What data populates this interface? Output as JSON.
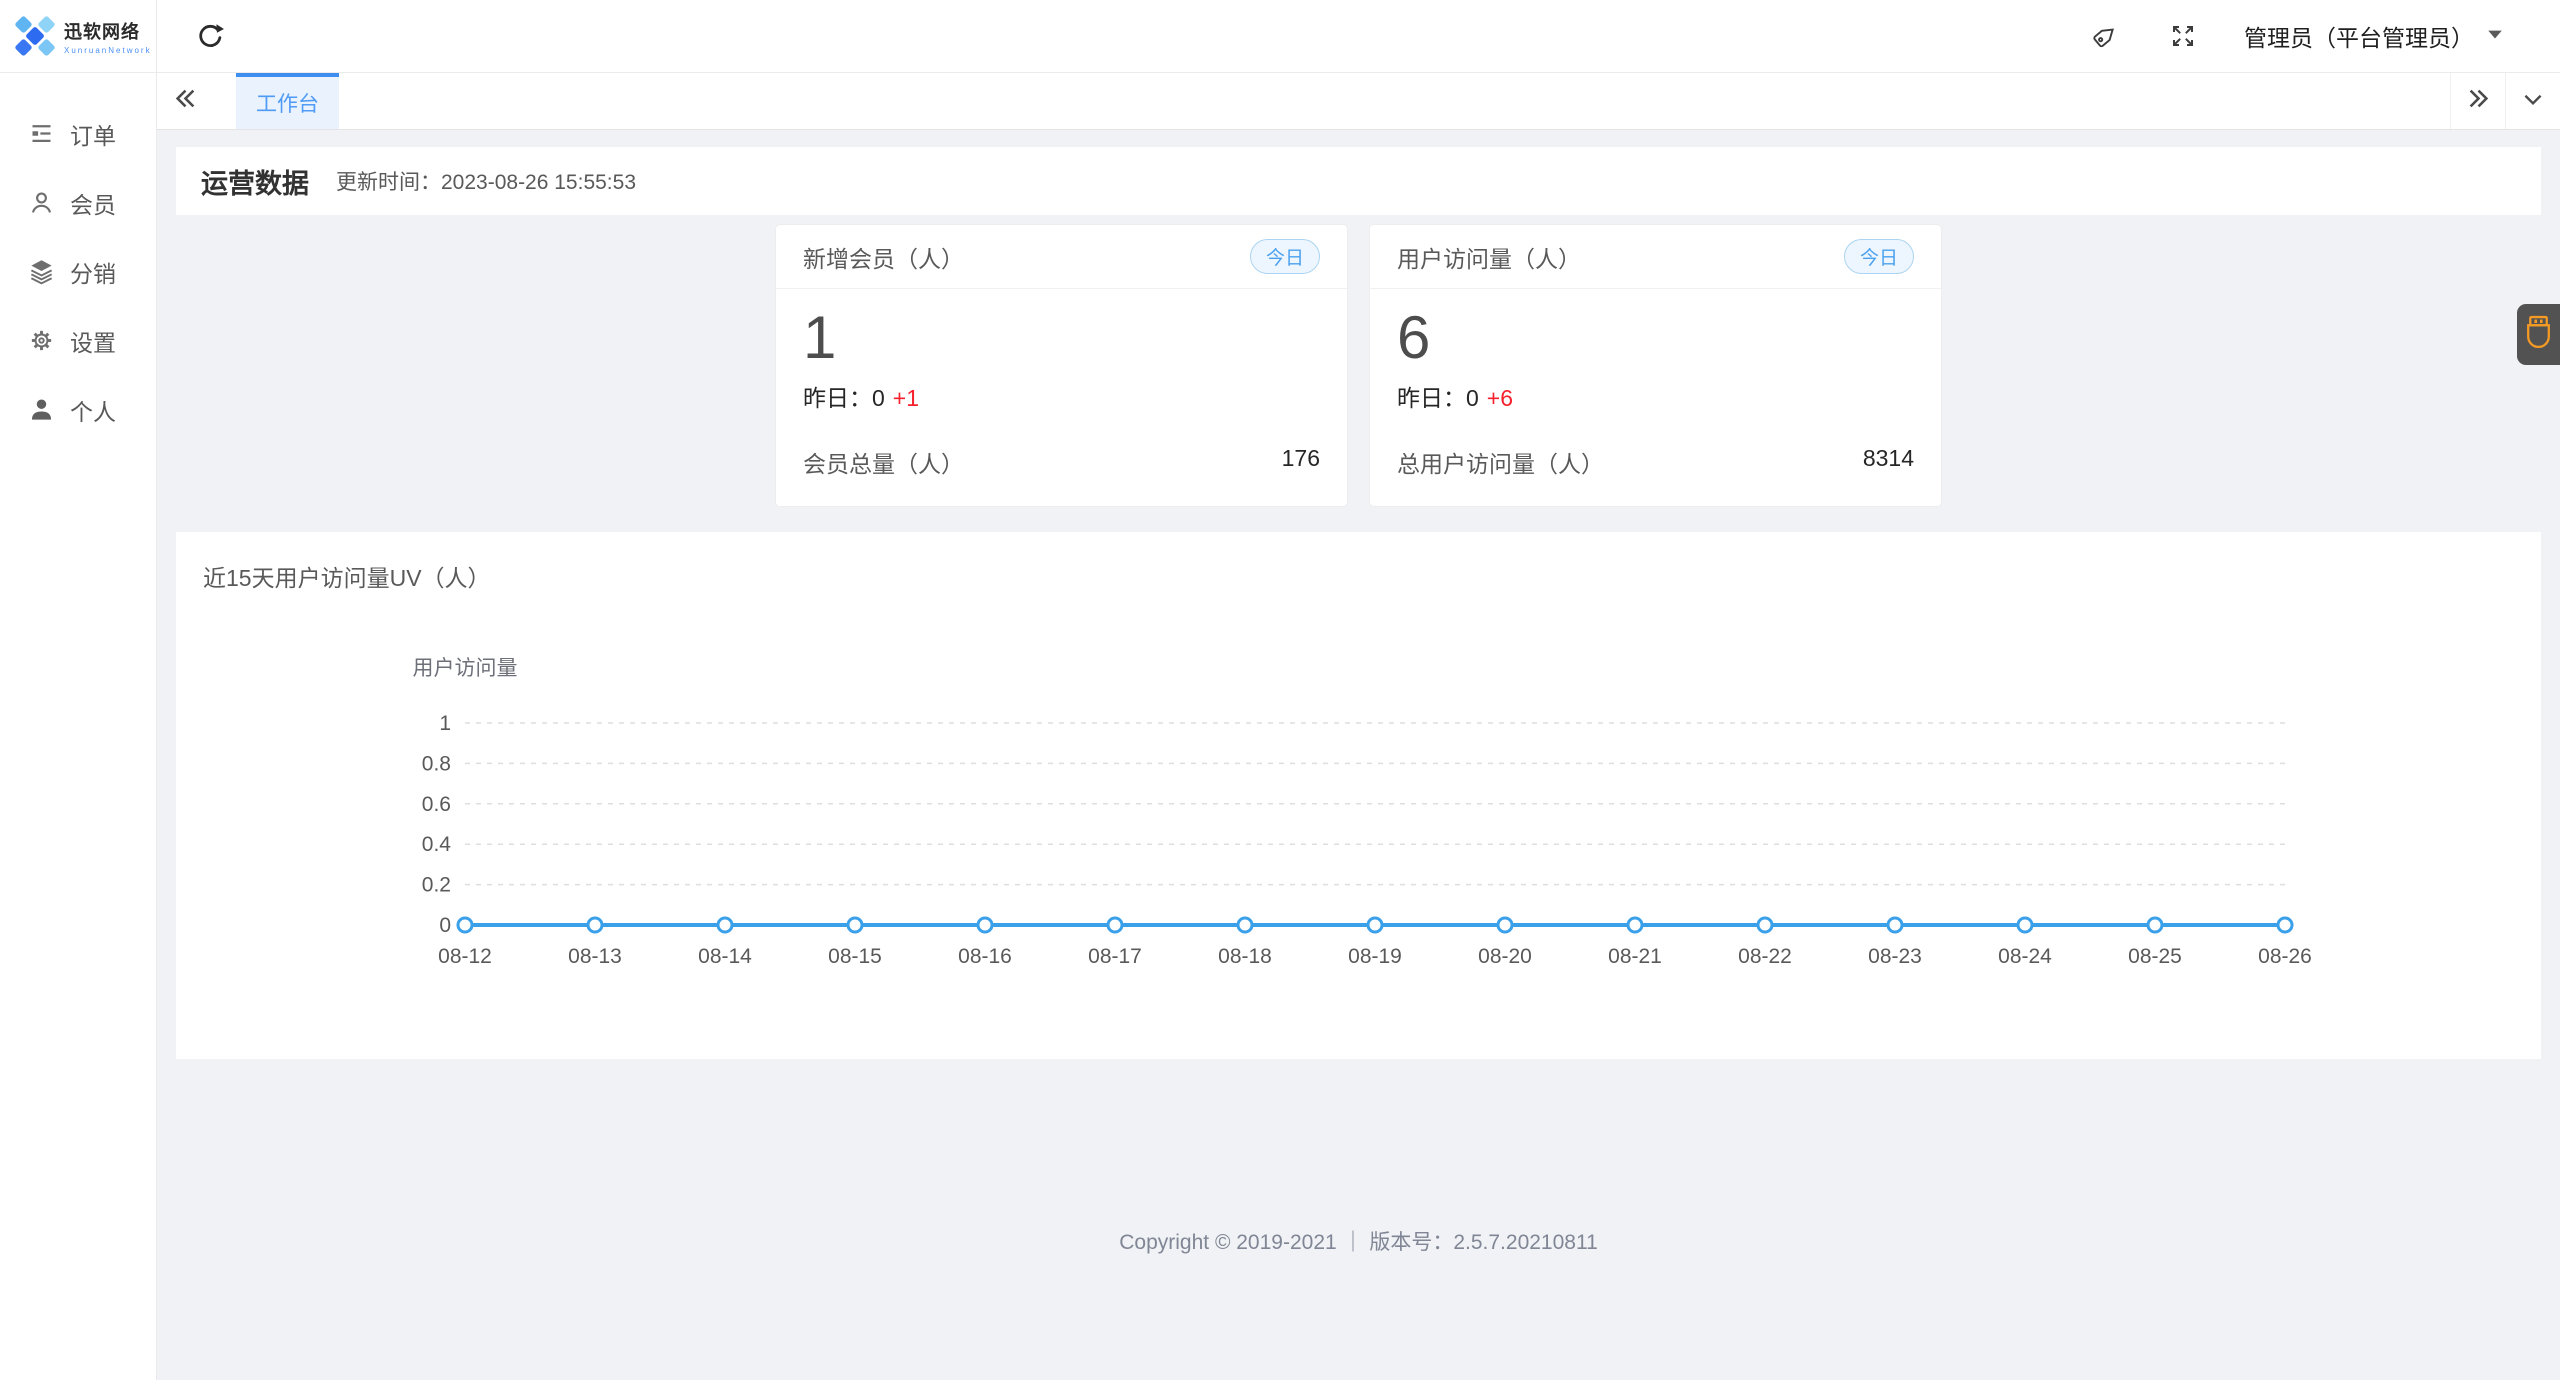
{
  "brand": {
    "name": "迅软网络",
    "subtitle": "XunruanNetwork"
  },
  "sidebar": {
    "items": [
      {
        "id": "orders",
        "label": "订单"
      },
      {
        "id": "members",
        "label": "会员"
      },
      {
        "id": "distribution",
        "label": "分销"
      },
      {
        "id": "settings",
        "label": "设置"
      },
      {
        "id": "profile",
        "label": "个人"
      }
    ]
  },
  "topbar": {
    "user_name": "管理员（平台管理员）"
  },
  "tabbar": {
    "active_tab": "工作台"
  },
  "overview": {
    "title": "运营数据",
    "updated_label": "更新时间：",
    "updated_time": "2023-08-26 15:55:53"
  },
  "stat_cards": [
    {
      "title": "新增会员（人）",
      "badge": "今日",
      "value": "1",
      "yesterday_label": "昨日：",
      "yesterday_base": "0",
      "yesterday_delta": "+1",
      "total_label": "会员总量（人）",
      "total_value": "176"
    },
    {
      "title": "用户访问量（人）",
      "badge": "今日",
      "value": "6",
      "yesterday_label": "昨日：",
      "yesterday_base": "0",
      "yesterday_delta": "+6",
      "total_label": "总用户访问量（人）",
      "total_value": "8314"
    }
  ],
  "chart_panel": {
    "title": "近15天用户访问量UV（人）"
  },
  "chart_data": {
    "type": "line",
    "title": "近15天用户访问量UV（人）",
    "ylabel": "用户访问量",
    "categories": [
      "08-12",
      "08-13",
      "08-14",
      "08-15",
      "08-16",
      "08-17",
      "08-18",
      "08-19",
      "08-20",
      "08-21",
      "08-22",
      "08-23",
      "08-24",
      "08-25",
      "08-26"
    ],
    "series": [
      {
        "name": "用户访问量",
        "values": [
          0,
          0,
          0,
          0,
          0,
          0,
          0,
          0,
          0,
          0,
          0,
          0,
          0,
          0,
          0
        ]
      }
    ],
    "yticks": [
      0,
      0.2,
      0.4,
      0.6,
      0.8,
      1
    ],
    "ylim": [
      0,
      1
    ],
    "grid": "horizontal-dashed",
    "legend_position": "none",
    "line_color": "#3aa0e9",
    "marker": "hollow-circle"
  },
  "footer": {
    "text": "Copyright © 2019-2021 ｜ 版本号：2.5.7.20210811"
  },
  "colors": {
    "accent": "#3e8ef0",
    "active_tab_bg": "#e9f2fd",
    "badge_blue": "#4aa0ef",
    "delta_red": "#f5222d",
    "float_btn_bg": "#444444",
    "float_btn_icon": "#f59a23",
    "page_bg": "#f0f2f5"
  }
}
